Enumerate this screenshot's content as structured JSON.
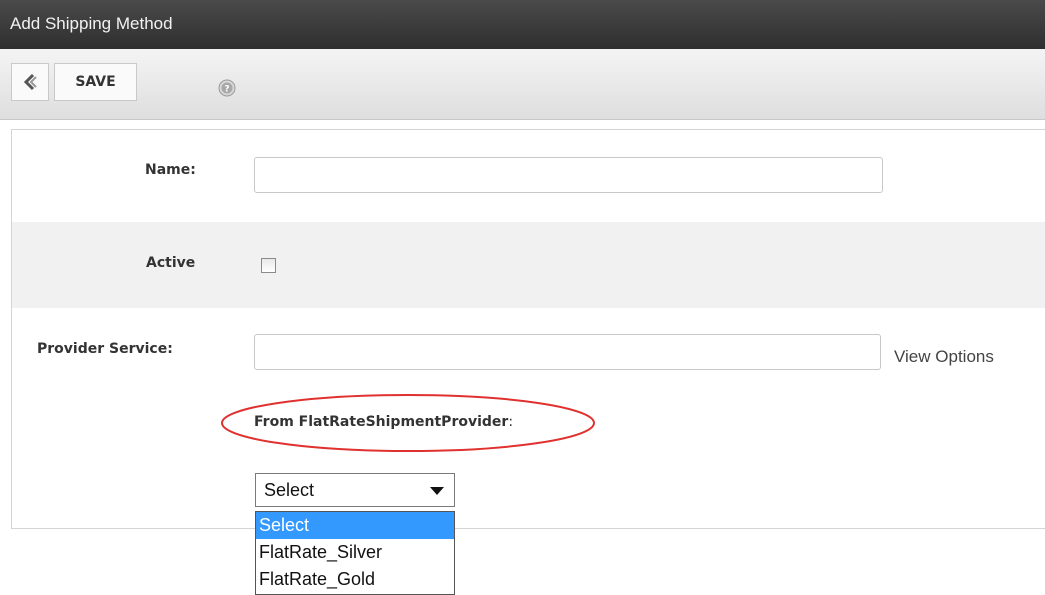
{
  "window": {
    "title": "Add Shipping Method"
  },
  "toolbar": {
    "save_label": "SAVE"
  },
  "form": {
    "name_label": "Name:",
    "name_value": "",
    "active_label": "Active",
    "active_checked": false,
    "provider_label": "Provider Service:",
    "provider_value": "",
    "view_options": "View Options",
    "from_provider": "From FlatRateShipmentProvider",
    "from_colon": ":"
  },
  "select": {
    "value": "Select",
    "options": [
      "Select",
      "FlatRate_Silver",
      "FlatRate_Gold"
    ],
    "highlighted": "Select"
  },
  "colors": {
    "highlight": "#3399ff",
    "annotation_oval": "#e0312f"
  },
  "icons": {
    "back": "chevron-left-icon",
    "help": "help-icon"
  }
}
